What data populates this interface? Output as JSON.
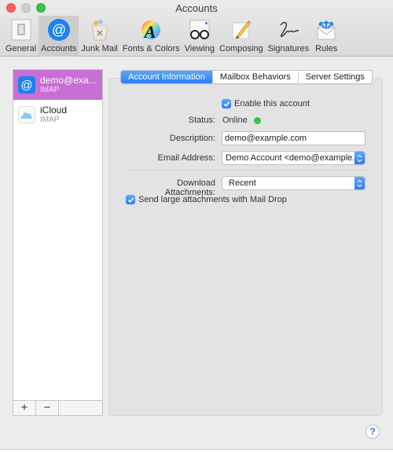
{
  "window": {
    "title": "Accounts"
  },
  "toolbar": {
    "items": [
      {
        "label": "General",
        "icon": "switch-icon"
      },
      {
        "label": "Accounts",
        "icon": "at-icon",
        "active": true
      },
      {
        "label": "Junk Mail",
        "icon": "trash-icon"
      },
      {
        "label": "Fonts & Colors",
        "icon": "font-color-icon"
      },
      {
        "label": "Viewing",
        "icon": "glasses-icon"
      },
      {
        "label": "Composing",
        "icon": "pencil-icon"
      },
      {
        "label": "Signatures",
        "icon": "signature-icon"
      },
      {
        "label": "Rules",
        "icon": "rules-envelope-icon"
      }
    ]
  },
  "accounts": [
    {
      "name": "demo@exa...",
      "type": "IMAP",
      "selected": true
    },
    {
      "name": "iCloud",
      "type": "IMAP",
      "selected": false
    }
  ],
  "list_footer": {
    "add": "+",
    "remove": "−"
  },
  "tabs": [
    {
      "label": "Account Information",
      "active": true
    },
    {
      "label": "Mailbox Behaviors",
      "active": false
    },
    {
      "label": "Server Settings",
      "active": false
    }
  ],
  "form": {
    "enable_label": "Enable this account",
    "enable_checked": true,
    "status_label": "Status:",
    "status_value": "Online",
    "status_color": "#2ec840",
    "description_label": "Description:",
    "description_value": "demo@example.com",
    "email_label": "Email Address:",
    "email_value": "Demo Account <demo@example.c...",
    "download_label": "Download Attachments:",
    "download_value": "Recent",
    "maildrop_label": "Send large attachments with Mail Drop",
    "maildrop_checked": true
  },
  "help": {
    "label": "?"
  },
  "colors": {
    "accent": "#2a7ef6",
    "selection": "#c86fd6"
  }
}
